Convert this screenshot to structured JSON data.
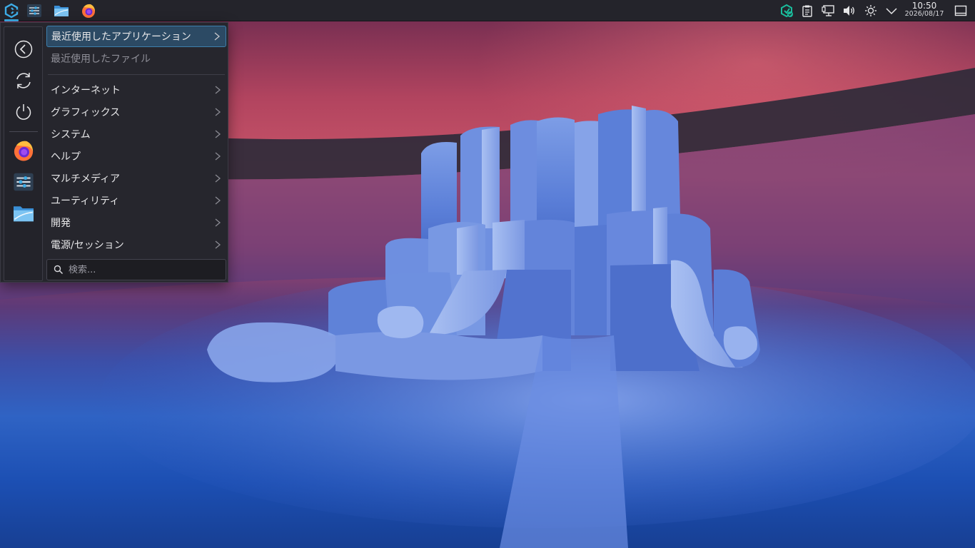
{
  "panel": {
    "launcher_icon": "kde-app-launcher-icon",
    "tasks": [
      {
        "name": "system-settings",
        "icon": "settings-sliders-icon"
      },
      {
        "name": "file-manager",
        "icon": "folder-icon"
      },
      {
        "name": "firefox",
        "icon": "firefox-icon"
      }
    ],
    "tray": [
      {
        "name": "discover-updates",
        "icon": "update-shield-icon"
      },
      {
        "name": "clipboard",
        "icon": "clipboard-icon"
      },
      {
        "name": "network",
        "icon": "network-wired-icon"
      },
      {
        "name": "volume",
        "icon": "speaker-icon"
      },
      {
        "name": "brightness",
        "icon": "sun-icon"
      },
      {
        "name": "tray-expander",
        "icon": "chevron-down-icon"
      }
    ],
    "clock": {
      "time": "10:50",
      "date": "2026/08/17"
    },
    "show_desktop_icon": "show-desktop-icon"
  },
  "launcher": {
    "favorites_side": [
      {
        "name": "back",
        "icon": "back-arrow-icon"
      },
      {
        "name": "refresh",
        "icon": "refresh-icon"
      },
      {
        "name": "power",
        "icon": "power-icon"
      },
      {
        "name": "firefox",
        "icon": "firefox-icon"
      },
      {
        "name": "system-settings",
        "icon": "settings-sliders-icon"
      },
      {
        "name": "file-manager",
        "icon": "folder-icon"
      }
    ],
    "items": [
      {
        "label": "最近使用したアプリケーション",
        "submenu": true
      },
      {
        "label": "最近使用したファイル",
        "submenu": false
      },
      {
        "label": "インターネット",
        "submenu": true
      },
      {
        "label": "グラフィックス",
        "submenu": true
      },
      {
        "label": "システム",
        "submenu": true
      },
      {
        "label": "ヘルプ",
        "submenu": true
      },
      {
        "label": "マルチメディア",
        "submenu": true
      },
      {
        "label": "ユーティリティ",
        "submenu": true
      },
      {
        "label": "開発",
        "submenu": true
      },
      {
        "label": "電源/セッション",
        "submenu": true
      }
    ],
    "search": {
      "placeholder": "検索..."
    }
  },
  "colors": {
    "accent": "#3daee9",
    "panel_bg": "#24242b",
    "menu_bg": "#26262d",
    "highlight_bg": "#2c4a64",
    "highlight_border": "#3d7fad"
  }
}
